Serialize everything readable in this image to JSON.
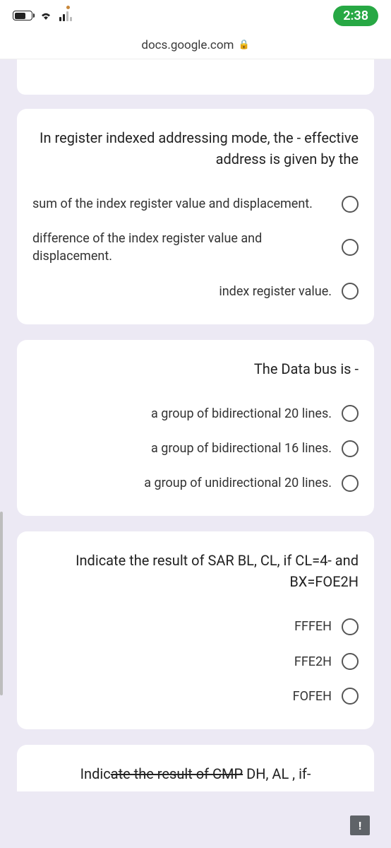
{
  "status": {
    "time": "2:38"
  },
  "address": {
    "domain": "docs.google.com"
  },
  "questions": [
    {
      "prompt": "In register indexed addressing mode, the - effective address is given by the",
      "options": [
        "sum of the index register value and displacement.",
        "difference of the index register value and displacement.",
        "index register value."
      ]
    },
    {
      "prompt": "The Data bus is -",
      "options": [
        "a group of bidirectional 20 lines.",
        "a group of bidirectional 16 lines.",
        "a group of unidirectional 20 lines."
      ]
    },
    {
      "prompt": "Indicate the result of SAR BL, CL, if CL=4- and BX=FOE2H",
      "options": [
        "FFFEH",
        "FFE2H",
        "FOFEH"
      ]
    },
    {
      "prompt_prefix": "Indic",
      "prompt_strike": "ate the result of CMP",
      "prompt_suffix": " DH, AL , if-"
    }
  ],
  "alert": "!"
}
